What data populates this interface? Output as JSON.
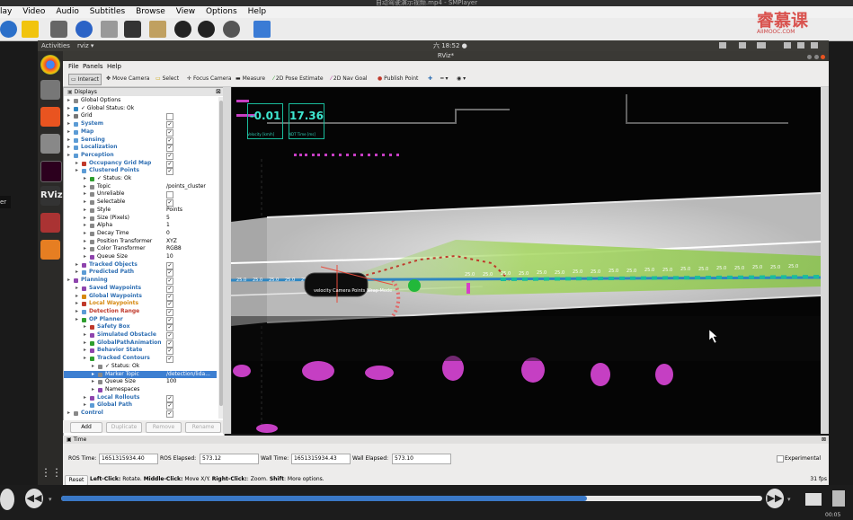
{
  "player": {
    "title": "自动驾驶演示视频.mp4 - SMPlayer",
    "menu": [
      "lay",
      "Video",
      "Audio",
      "Subtitles",
      "Browse",
      "View",
      "Options",
      "Help"
    ],
    "watermark": "睿慕课",
    "watermark_sub": "AIIMOOC.COM",
    "time_elapsed": "00:05",
    "side_label": "er"
  },
  "ubuntu": {
    "activities": "Activities",
    "app_menu": "rviz ▾",
    "clock": "六 18:52 ●"
  },
  "rviz": {
    "title": "RViz*",
    "menu": [
      "File",
      "Panels",
      "Help"
    ],
    "tools": [
      "Interact",
      "Move Camera",
      "Select",
      "Focus Camera",
      "Measure",
      "2D Pose Estimate",
      "2D Nav Goal",
      "Publish Point"
    ],
    "displays_title": "Displays",
    "tree": [
      {
        "label": "Global Options",
        "indent": 0,
        "style": "",
        "value": ""
      },
      {
        "label": "✓ Global Status: Ok",
        "indent": 0,
        "style": "",
        "value": ""
      },
      {
        "label": "Grid",
        "indent": 0,
        "style": "",
        "check": ""
      },
      {
        "label": "System",
        "indent": 0,
        "style": "bluetxt",
        "check": "✓"
      },
      {
        "label": "Map",
        "indent": 0,
        "style": "bluetxt",
        "check": "✓"
      },
      {
        "label": "Sensing",
        "indent": 0,
        "style": "bluetxt",
        "check": "✓"
      },
      {
        "label": "Localization",
        "indent": 0,
        "style": "bluetxt",
        "check": "✓"
      },
      {
        "label": "Perception",
        "indent": 0,
        "style": "bluetxt",
        "check": "✓"
      },
      {
        "label": "Occupancy Grid Map",
        "indent": 1,
        "style": "bluetxt",
        "check": "✓"
      },
      {
        "label": "Clustered Points",
        "indent": 1,
        "style": "bluetxt",
        "check": "✓"
      },
      {
        "label": "✓ Status: Ok",
        "indent": 2,
        "style": "",
        "value": ""
      },
      {
        "label": "Topic",
        "indent": 2,
        "style": "",
        "value": "/points_cluster"
      },
      {
        "label": "Unreliable",
        "indent": 2,
        "style": "",
        "check": ""
      },
      {
        "label": "Selectable",
        "indent": 2,
        "style": "",
        "check": "✓"
      },
      {
        "label": "Style",
        "indent": 2,
        "style": "",
        "value": "Points"
      },
      {
        "label": "Size (Pixels)",
        "indent": 2,
        "style": "",
        "value": "5"
      },
      {
        "label": "Alpha",
        "indent": 2,
        "style": "",
        "value": "1"
      },
      {
        "label": "Decay Time",
        "indent": 2,
        "style": "",
        "value": "0"
      },
      {
        "label": "Position Transformer",
        "indent": 2,
        "style": "",
        "value": "XYZ"
      },
      {
        "label": "Color Transformer",
        "indent": 2,
        "style": "",
        "value": "RGB8"
      },
      {
        "label": "Queue Size",
        "indent": 2,
        "style": "",
        "value": "10"
      },
      {
        "label": "Tracked Objects",
        "indent": 1,
        "style": "bluetxt",
        "check": "✓"
      },
      {
        "label": "Predicted Path",
        "indent": 1,
        "style": "bluetxt",
        "check": "✓"
      },
      {
        "label": "Planning",
        "indent": 0,
        "style": "bluetxt",
        "check": "✓"
      },
      {
        "label": "Saved Waypoints",
        "indent": 1,
        "style": "bluetxt",
        "check": "✓"
      },
      {
        "label": "Global Waypoints",
        "indent": 1,
        "style": "bluetxt",
        "check": "✓"
      },
      {
        "label": "Local Waypoints",
        "indent": 1,
        "style": "orgtxt",
        "check": "✓"
      },
      {
        "label": "Detection Range",
        "indent": 1,
        "style": "redtxt",
        "check": "✓"
      },
      {
        "label": "OP Planner",
        "indent": 1,
        "style": "bluetxt",
        "check": "✓"
      },
      {
        "label": "Safety Box",
        "indent": 2,
        "style": "bluetxt",
        "check": "✓"
      },
      {
        "label": "Simulated Obstacle",
        "indent": 2,
        "style": "bluetxt",
        "check": "✓"
      },
      {
        "label": "GlobalPathAnimation",
        "indent": 2,
        "style": "bluetxt",
        "check": "✓"
      },
      {
        "label": "Behavior State",
        "indent": 2,
        "style": "bluetxt",
        "check": "✓"
      },
      {
        "label": "Tracked Contours",
        "indent": 2,
        "style": "bluetxt",
        "check": "✓"
      },
      {
        "label": "✓ Status: Ok",
        "indent": 3,
        "style": "",
        "value": ""
      },
      {
        "label": "Marker Topic",
        "indent": 3,
        "style": "sel",
        "value": "/detection/lida..."
      },
      {
        "label": "Queue Size",
        "indent": 3,
        "style": "",
        "value": "100"
      },
      {
        "label": "Namespaces",
        "indent": 3,
        "style": "",
        "value": ""
      },
      {
        "label": "Local Rollouts",
        "indent": 2,
        "style": "bluetxt",
        "check": "✓"
      },
      {
        "label": "Global Path",
        "indent": 2,
        "style": "bluetxt",
        "check": "✓"
      },
      {
        "label": "Control",
        "indent": 0,
        "style": "bluetxt",
        "check": "✓"
      }
    ],
    "panel_buttons": [
      "Add",
      "Duplicate",
      "Remove",
      "Rename"
    ],
    "overlay": {
      "velocity_value": "-0.01",
      "velocity_label": "Velocity [km/h]",
      "ndt_value": "17.36",
      "ndt_label": "NDT Time [ms]"
    },
    "ego_label": "velocity Camera Points Wrap Mode",
    "waypoint_label": "25.0",
    "time": {
      "title": "Time",
      "ros_time_label": "ROS Time:",
      "ros_time": "1651315934.40",
      "ros_elapsed_label": "ROS Elapsed:",
      "ros_elapsed": "573.12",
      "wall_time_label": "Wall Time:",
      "wall_time": "1651315934.43",
      "wall_elapsed_label": "Wall Elapsed:",
      "wall_elapsed": "573.10",
      "experimental": "Experimental",
      "reset": "Reset",
      "hint_left": "Left-Click:",
      "hint_left_t": " Rotate. ",
      "hint_mid": "Middle-Click:",
      "hint_mid_t": " Move X/Y. ",
      "hint_right": "Right-Click:",
      "hint_right_t": ": Zoom. ",
      "hint_shift": "Shift",
      "hint_shift_t": ": More options.",
      "fps": "31 fps"
    }
  }
}
